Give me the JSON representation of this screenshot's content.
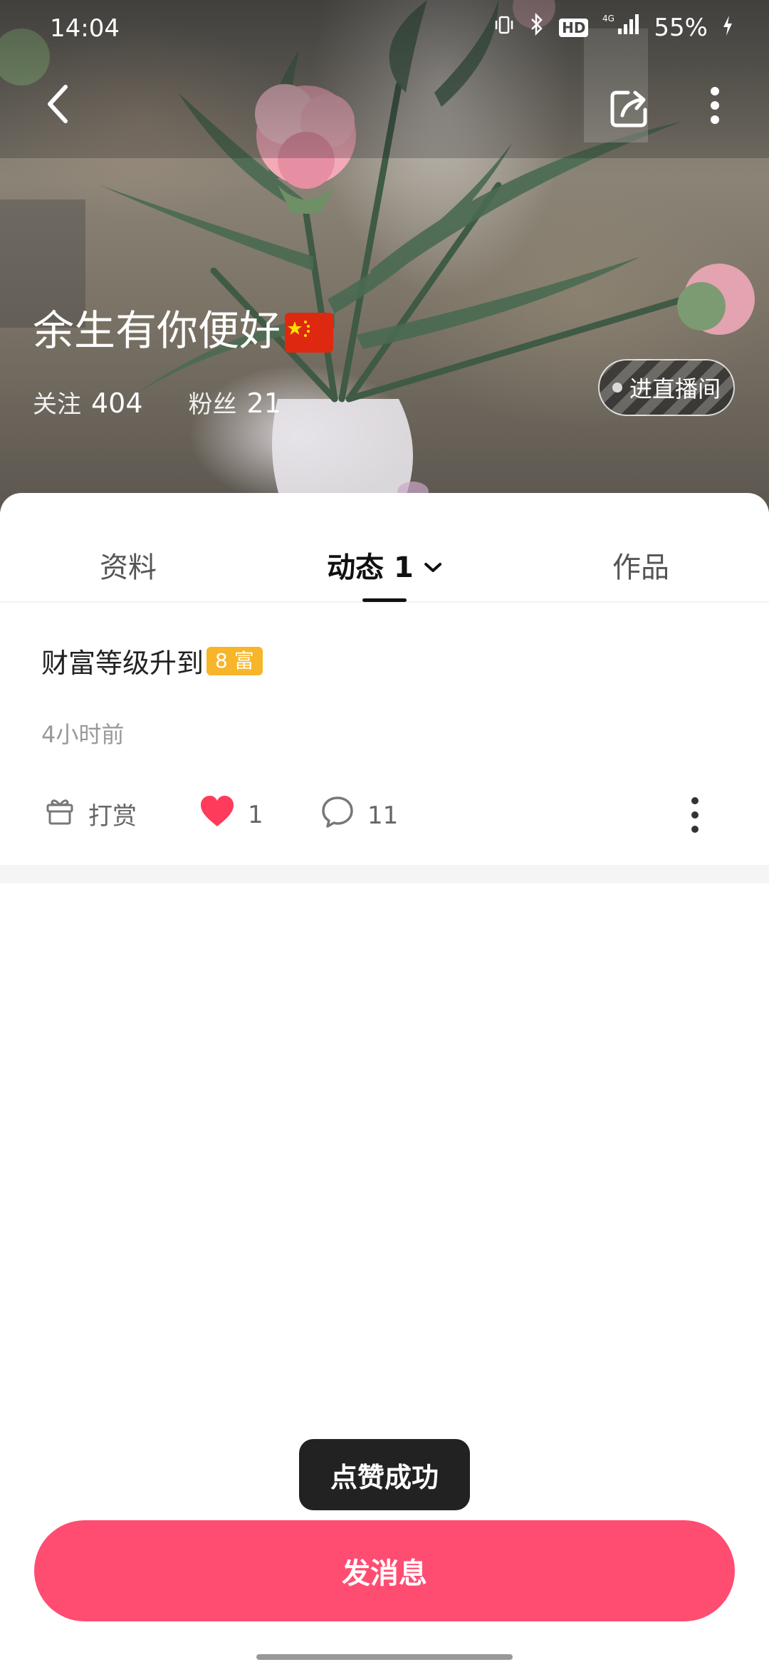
{
  "status_bar": {
    "time": "14:04",
    "network": "4G",
    "battery": "55%",
    "icons": [
      "vibrate-icon",
      "bluetooth-icon",
      "hd-icon",
      "signal-icon",
      "battery-icon"
    ]
  },
  "header": {
    "back_icon": "chevron-left-icon",
    "share_icon": "share-icon",
    "more_icon": "more-vertical-icon"
  },
  "profile": {
    "name": "余生有你便好",
    "flag_icon": "china-flag-icon",
    "following_label": "关注",
    "following_count": "404",
    "followers_label": "粉丝",
    "followers_count": "21",
    "live_button": "进直播间"
  },
  "tabs": {
    "profile": "资料",
    "feed": "动态 1",
    "works": "作品",
    "active": "feed"
  },
  "post": {
    "title": "财富等级升到",
    "badge": "8 富",
    "badge_color": "#f7b52a",
    "time": "4小时前",
    "reward_label": "打赏",
    "like_count": "1",
    "comment_count": "11"
  },
  "toast": "点赞成功",
  "send_message_button": "发消息",
  "colors": {
    "accent": "#ff4d72",
    "like": "#ff3b5c"
  }
}
